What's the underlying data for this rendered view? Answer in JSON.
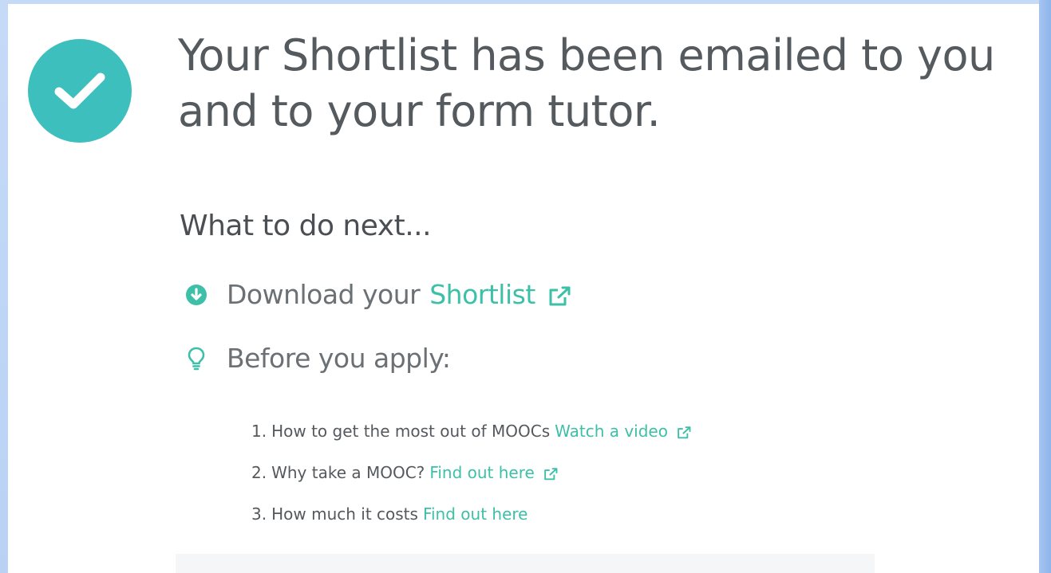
{
  "confirmation": {
    "headline": "Your Shortlist has been emailed to you and to your form tutor.",
    "badge_icon": "check-icon",
    "badge_color": "#3dbfbd"
  },
  "next_steps": {
    "heading": "What to do next...",
    "download": {
      "icon": "download-circle-icon",
      "prefix": "Download your",
      "link_label": "Shortlist",
      "link_icon": "external-link-icon"
    },
    "before_apply": {
      "icon": "lightbulb-icon",
      "label": "Before you apply:"
    },
    "items": [
      {
        "number": "1.",
        "text": "How to get the most out of MOOCs",
        "link": "Watch a video",
        "external": true
      },
      {
        "number": "2.",
        "text": "Why take a MOOC?",
        "link": "Find out here",
        "external": true
      },
      {
        "number": "3.",
        "text": "How much it costs",
        "link": "Find out here",
        "external": false
      }
    ]
  },
  "colors": {
    "accent": "#3dbfa8",
    "text": "#55595d",
    "background_frame": "#c5daf7"
  }
}
